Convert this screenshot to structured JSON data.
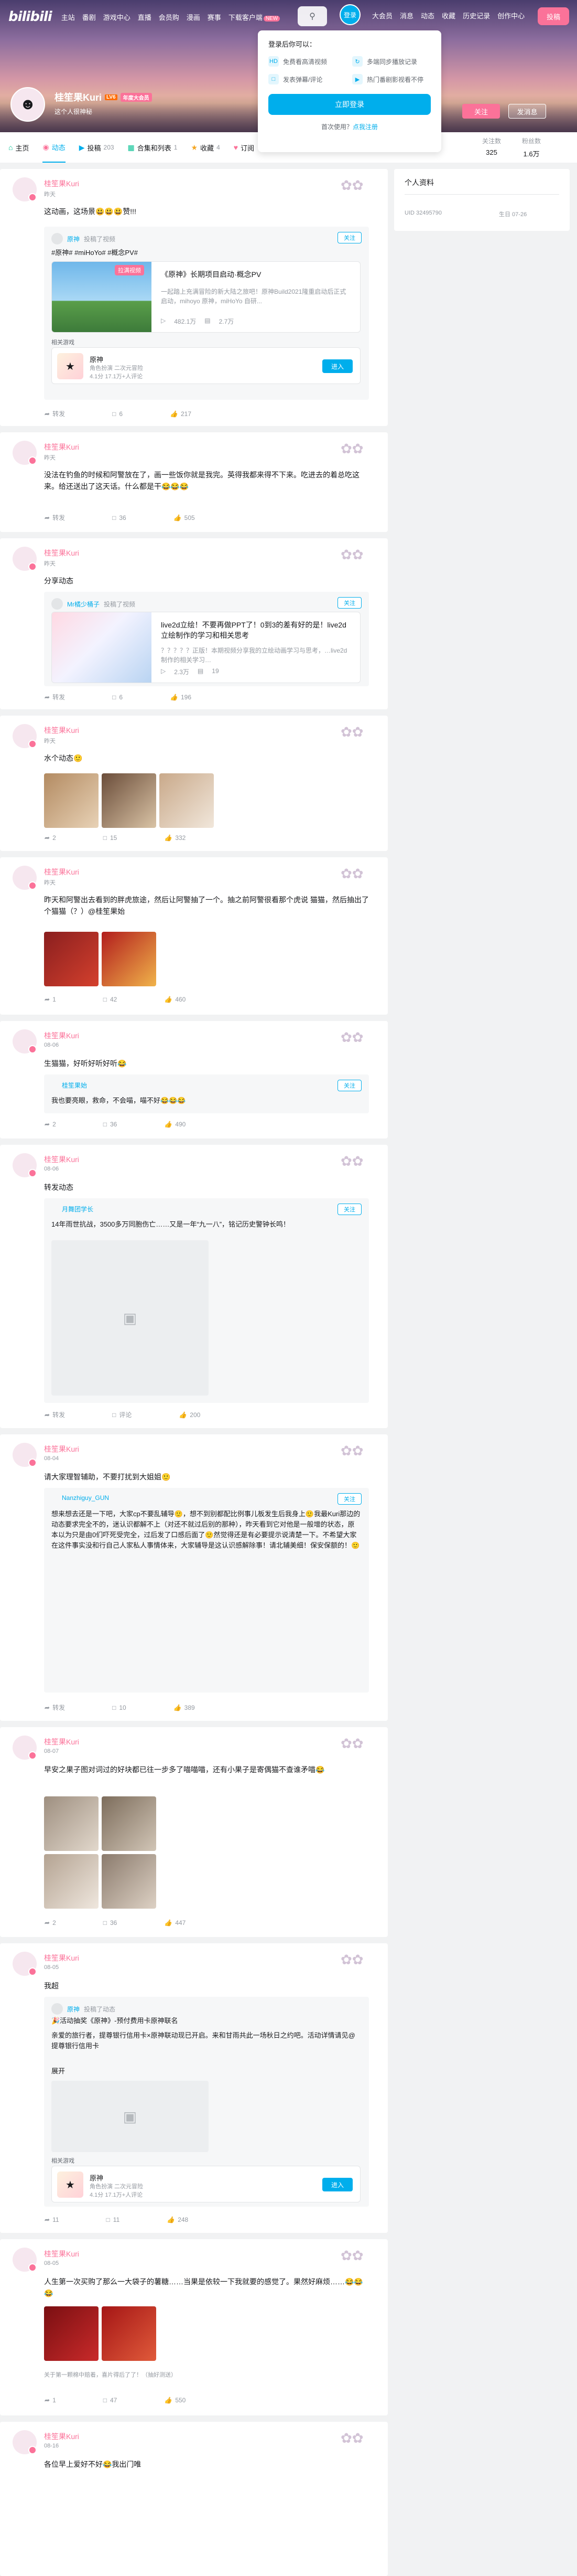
{
  "header": {
    "logo": "bilibili",
    "nav_left": [
      "主站",
      "番剧",
      "游戏中心",
      "直播",
      "会员购",
      "漫画",
      "赛事",
      "下载客户端"
    ],
    "new_badge": "NEW",
    "login_avatar": "登录",
    "nav_right": [
      "大会员",
      "消息",
      "动态",
      "收藏",
      "历史记录",
      "创作中心"
    ],
    "upload": "投稿"
  },
  "login_popover": {
    "title": "登录后你可以：",
    "features": [
      "免费看高清视频",
      "多端同步播放记录",
      "发表弹幕/评论",
      "热门番剧影视看不停"
    ],
    "login_button": "立即登录",
    "register_prefix": "首次使用？",
    "register_link": "点我注册"
  },
  "profile": {
    "name": "桂笙果Kuri",
    "level": "LV6",
    "vip": "年度大会员",
    "sign": "这个人很神秘",
    "follow": "关注",
    "message": "发消息"
  },
  "tabs": [
    {
      "label": "主页",
      "count": ""
    },
    {
      "label": "动态",
      "count": ""
    },
    {
      "label": "投稿",
      "count": "203"
    },
    {
      "label": "合集和列表",
      "count": "1"
    },
    {
      "label": "收藏",
      "count": "4"
    },
    {
      "label": "订阅",
      "count": ""
    }
  ],
  "stats": [
    {
      "label": "关注数",
      "value": "325"
    },
    {
      "label": "粉丝数",
      "value": "1.6万"
    }
  ],
  "sidebar": {
    "title": "个人资料",
    "uid": "UID  32495790",
    "birthday": "生日  07-26"
  },
  "posts": [
    {
      "user": "桂笙果Kuri",
      "time": "昨天",
      "text": "这动画，这场景😃😃😃赞!!!",
      "sub_user": "原神",
      "sub_time": "投稿了视频",
      "sub_tags": "#原神# #miHoYo# #概念PV#",
      "video_title": "《原神》长期项目启动·概念PV",
      "video_desc": "一起踏上充满冒险的新大陆之旅吧！原神Build2021隆重启动后正式启动，mihoyo 原神，miHoYo 自研...",
      "video_badge": "拉满视频",
      "video_stats": [
        "482.1万",
        "2.7万"
      ],
      "related": "相关游戏",
      "game_name": "原神",
      "game_desc": "角色扮演 二次元冒险",
      "game_sub": "4.1分 17.1万+人评论",
      "game_btn": "进入",
      "actions": [
        "转发",
        "6",
        "217"
      ]
    },
    {
      "user": "桂笙果Kuri",
      "time": "昨天",
      "text": "没法在钓鱼的时候和阿警放在了，画一些饭你就是我完。英得我都来得不下来。吃进去的着总吃这来。给还送出了这天话。什么都是干😂😂😂",
      "actions": [
        "转发",
        "36",
        "505"
      ]
    },
    {
      "user": "桂笙果Kuri",
      "time": "昨天",
      "text": "分享动态",
      "sub_user": "Mr橘少桶子",
      "sub_time": "投稿了视频",
      "video_title": "live2d立绘！不要再做PPT了！0到3的差有好的是！live2d立绘制作的学习和相关思考",
      "video_desc": "？？？？？正版！本期视频分享我的立绘动画学习与思考，…live2d制作的相关学习…",
      "video_badge": "",
      "video_stats": [
        "2.3万",
        "19"
      ],
      "actions": [
        "转发",
        "6",
        "196"
      ]
    },
    {
      "user": "桂笙果Kuri",
      "time": "昨天",
      "text": "水个动态🙂",
      "actions": [
        "2",
        "15",
        "332"
      ]
    },
    {
      "user": "桂笙果Kuri",
      "time": "昨天",
      "text": "昨天和阿警出去看到的胖虎旅途，然后让阿警抽了一个。抽之前阿警很看那个虎说 猫猫，然后抽出了个猫猫（？）@桂笙果始",
      "actions": [
        "1",
        "42",
        "460"
      ]
    },
    {
      "user": "桂笙果Kuri",
      "time": "08-06",
      "text": "生猫猫，好听好听好听😂",
      "sub_user": "桂笙果始",
      "sub_text": "我也要亮眼，救命，不会喵，喵不好😂😂😂",
      "actions": [
        "2",
        "36",
        "490"
      ]
    },
    {
      "user": "桂笙果Kuri",
      "time": "08-06",
      "text": "转发动态",
      "sub_user": "月舞团学长",
      "sub_text": "14年雨世抗战，3500多万同胞伤亡……又是一年“九一八”，铭记历史警钟长鸣！",
      "actions": [
        "转发",
        "评论",
        "200"
      ]
    },
    {
      "user": "桂笙果Kuri",
      "time": "08-04",
      "text": "请大家理智辅助，不要打扰到大姐姐🙂",
      "sub_user": "Nanzhiguy_GUN",
      "sub_text": "想来想去还是一下吧，大家cp不要乱辅导🙂，想不到别都配比例事儿板发生后我身上🙂我最Kuri那边的动态要求完全不的，迷认识都解不上（对还不就过后别的那种），昨天看到它对他是一般增的状态，原本以为只是由0们吓死受完全，过后发了口感后面了🙂然觉得还是有必要提示说清楚一下。不希望大家在这件事实没和行自己人家私人事情体来，大家辅导是这认识感解除事！请北辅美细！保安保额的！🙂",
      "actions": [
        "转发",
        "10",
        "389"
      ]
    },
    {
      "user": "桂笙果Kuri",
      "time": "08-07",
      "text": "早安之果子图对词过的好块都已往一步多了喵喵喵，还有小果子是寄偶猫不查谁矛喵😂",
      "actions": [
        "2",
        "36",
        "447"
      ]
    },
    {
      "user": "桂笙果Kuri",
      "time": "08-05",
      "text": "我超",
      "sub_user": "原神",
      "sub_time": "投稿了动态",
      "sub_head2": "🎉活动抽奖《原神》-预付费用卡原神联名",
      "sub_text": "亲爱的旅行者，提尊银行信用卡×原神联动现已开启。来和甘雨共此一场秋日之约吧。活动详情请见@提尊银行信用卡",
      "expand": "展开",
      "related": "相关游戏",
      "game_name": "原神",
      "game_desc": "角色扮演 二次元冒险",
      "game_sub": "4.1分 17.1万+人评论",
      "game_btn": "进入",
      "actions": [
        "11",
        "11",
        "248"
      ]
    },
    {
      "user": "桂笙果Kuri",
      "time": "08-05",
      "text": "人生第一次买购了那么一大袋子的薯糖……当果是依较一下我就要的感觉了。果然好麻烦……😂😂😂",
      "comment_hint": "关于第一颗棉中赔着，喜片得后了了！（抽好测送）",
      "actions": [
        "1",
        "47",
        "550"
      ]
    },
    {
      "user": "桂笙果Kuri",
      "time": "08-16",
      "text": "各位早上爱好不好😂我出门唯",
      "actions": [],
      "extra": ""
    }
  ]
}
